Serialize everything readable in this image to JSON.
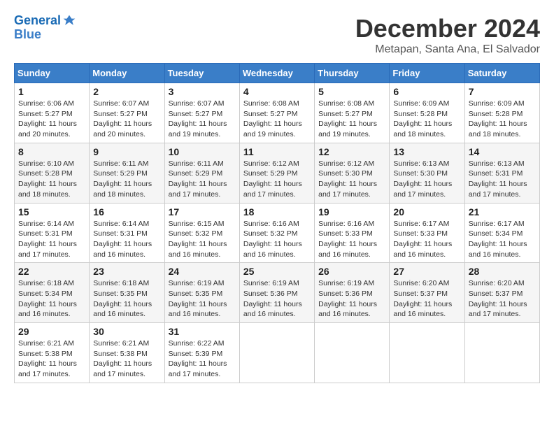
{
  "logo": {
    "line1": "General",
    "line2": "Blue"
  },
  "title": "December 2024",
  "location": "Metapan, Santa Ana, El Salvador",
  "weekdays": [
    "Sunday",
    "Monday",
    "Tuesday",
    "Wednesday",
    "Thursday",
    "Friday",
    "Saturday"
  ],
  "weeks": [
    [
      {
        "day": "1",
        "info": "Sunrise: 6:06 AM\nSunset: 5:27 PM\nDaylight: 11 hours\nand 20 minutes."
      },
      {
        "day": "2",
        "info": "Sunrise: 6:07 AM\nSunset: 5:27 PM\nDaylight: 11 hours\nand 20 minutes."
      },
      {
        "day": "3",
        "info": "Sunrise: 6:07 AM\nSunset: 5:27 PM\nDaylight: 11 hours\nand 19 minutes."
      },
      {
        "day": "4",
        "info": "Sunrise: 6:08 AM\nSunset: 5:27 PM\nDaylight: 11 hours\nand 19 minutes."
      },
      {
        "day": "5",
        "info": "Sunrise: 6:08 AM\nSunset: 5:27 PM\nDaylight: 11 hours\nand 19 minutes."
      },
      {
        "day": "6",
        "info": "Sunrise: 6:09 AM\nSunset: 5:28 PM\nDaylight: 11 hours\nand 18 minutes."
      },
      {
        "day": "7",
        "info": "Sunrise: 6:09 AM\nSunset: 5:28 PM\nDaylight: 11 hours\nand 18 minutes."
      }
    ],
    [
      {
        "day": "8",
        "info": "Sunrise: 6:10 AM\nSunset: 5:28 PM\nDaylight: 11 hours\nand 18 minutes."
      },
      {
        "day": "9",
        "info": "Sunrise: 6:11 AM\nSunset: 5:29 PM\nDaylight: 11 hours\nand 18 minutes."
      },
      {
        "day": "10",
        "info": "Sunrise: 6:11 AM\nSunset: 5:29 PM\nDaylight: 11 hours\nand 17 minutes."
      },
      {
        "day": "11",
        "info": "Sunrise: 6:12 AM\nSunset: 5:29 PM\nDaylight: 11 hours\nand 17 minutes."
      },
      {
        "day": "12",
        "info": "Sunrise: 6:12 AM\nSunset: 5:30 PM\nDaylight: 11 hours\nand 17 minutes."
      },
      {
        "day": "13",
        "info": "Sunrise: 6:13 AM\nSunset: 5:30 PM\nDaylight: 11 hours\nand 17 minutes."
      },
      {
        "day": "14",
        "info": "Sunrise: 6:13 AM\nSunset: 5:31 PM\nDaylight: 11 hours\nand 17 minutes."
      }
    ],
    [
      {
        "day": "15",
        "info": "Sunrise: 6:14 AM\nSunset: 5:31 PM\nDaylight: 11 hours\nand 17 minutes."
      },
      {
        "day": "16",
        "info": "Sunrise: 6:14 AM\nSunset: 5:31 PM\nDaylight: 11 hours\nand 16 minutes."
      },
      {
        "day": "17",
        "info": "Sunrise: 6:15 AM\nSunset: 5:32 PM\nDaylight: 11 hours\nand 16 minutes."
      },
      {
        "day": "18",
        "info": "Sunrise: 6:16 AM\nSunset: 5:32 PM\nDaylight: 11 hours\nand 16 minutes."
      },
      {
        "day": "19",
        "info": "Sunrise: 6:16 AM\nSunset: 5:33 PM\nDaylight: 11 hours\nand 16 minutes."
      },
      {
        "day": "20",
        "info": "Sunrise: 6:17 AM\nSunset: 5:33 PM\nDaylight: 11 hours\nand 16 minutes."
      },
      {
        "day": "21",
        "info": "Sunrise: 6:17 AM\nSunset: 5:34 PM\nDaylight: 11 hours\nand 16 minutes."
      }
    ],
    [
      {
        "day": "22",
        "info": "Sunrise: 6:18 AM\nSunset: 5:34 PM\nDaylight: 11 hours\nand 16 minutes."
      },
      {
        "day": "23",
        "info": "Sunrise: 6:18 AM\nSunset: 5:35 PM\nDaylight: 11 hours\nand 16 minutes."
      },
      {
        "day": "24",
        "info": "Sunrise: 6:19 AM\nSunset: 5:35 PM\nDaylight: 11 hours\nand 16 minutes."
      },
      {
        "day": "25",
        "info": "Sunrise: 6:19 AM\nSunset: 5:36 PM\nDaylight: 11 hours\nand 16 minutes."
      },
      {
        "day": "26",
        "info": "Sunrise: 6:19 AM\nSunset: 5:36 PM\nDaylight: 11 hours\nand 16 minutes."
      },
      {
        "day": "27",
        "info": "Sunrise: 6:20 AM\nSunset: 5:37 PM\nDaylight: 11 hours\nand 16 minutes."
      },
      {
        "day": "28",
        "info": "Sunrise: 6:20 AM\nSunset: 5:37 PM\nDaylight: 11 hours\nand 17 minutes."
      }
    ],
    [
      {
        "day": "29",
        "info": "Sunrise: 6:21 AM\nSunset: 5:38 PM\nDaylight: 11 hours\nand 17 minutes."
      },
      {
        "day": "30",
        "info": "Sunrise: 6:21 AM\nSunset: 5:38 PM\nDaylight: 11 hours\nand 17 minutes."
      },
      {
        "day": "31",
        "info": "Sunrise: 6:22 AM\nSunset: 5:39 PM\nDaylight: 11 hours\nand 17 minutes."
      },
      {
        "day": "",
        "info": ""
      },
      {
        "day": "",
        "info": ""
      },
      {
        "day": "",
        "info": ""
      },
      {
        "day": "",
        "info": ""
      }
    ]
  ]
}
